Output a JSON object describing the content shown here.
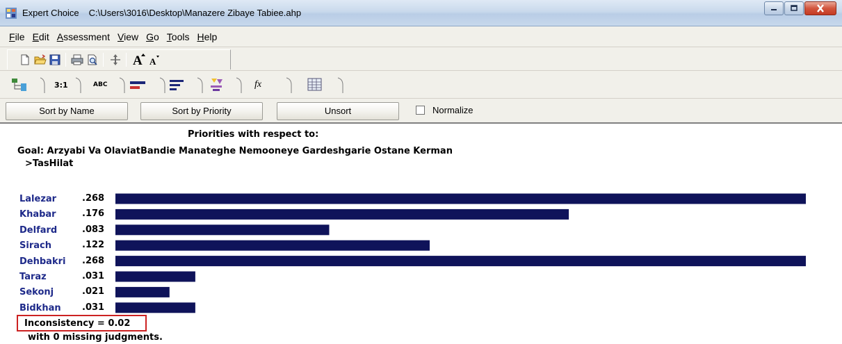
{
  "window": {
    "app_name": "Expert Choice",
    "file_path": "C:\\Users\\3016\\Desktop\\Manazere Zibaye Tabiee.ahp",
    "minimize_icon": "minimize-icon",
    "maximize_icon": "maximize-icon",
    "close_icon": "close-icon"
  },
  "menu": {
    "items": [
      {
        "label": "File",
        "key": "F",
        "rest": "ile"
      },
      {
        "label": "Edit",
        "key": "E",
        "rest": "dit"
      },
      {
        "label": "Assessment",
        "key": "A",
        "rest": "ssessment"
      },
      {
        "label": "View",
        "key": "V",
        "rest": "iew"
      },
      {
        "label": "Go",
        "key": "G",
        "rest": "o"
      },
      {
        "label": "Tools",
        "key": "T",
        "rest": "ools"
      },
      {
        "label": "Help",
        "key": "H",
        "rest": "elp"
      }
    ]
  },
  "toolbar": {
    "icons": [
      "new-file-icon",
      "open-folder-icon",
      "save-icon",
      "print-icon",
      "print-preview-icon",
      "move-icon",
      "increase-font-icon",
      "decrease-font-icon"
    ]
  },
  "tabs": {
    "items": [
      {
        "name": "tree-view-tab",
        "label": ""
      },
      {
        "name": "pairwise-numerical-tab",
        "label": "3:1"
      },
      {
        "name": "verbal-tab",
        "label": "ABC"
      },
      {
        "name": "graphical-tab",
        "label": ""
      },
      {
        "name": "priorities-tab",
        "label": ""
      },
      {
        "name": "sensitivity-tab",
        "label": ""
      },
      {
        "name": "formula-tab",
        "label": "fx"
      },
      {
        "name": "grid-tab",
        "label": ""
      }
    ]
  },
  "sortbar": {
    "sort_by_name": "Sort by Name",
    "sort_by_priority": "Sort by Priority",
    "unsort": "Unsort",
    "normalize": "Normalize",
    "normalize_checked": false
  },
  "report": {
    "heading": "Priorities with respect to:",
    "goal": "Goal: Arzyabi Va OlaviatBandie Manateghe Nemooneye Gardeshgarie Ostane Kerman",
    "node": ">TasHilat",
    "inconsistency": "Inconsistency = 0.02",
    "missing": "with 0  missing judgments."
  },
  "chart_data": {
    "type": "bar",
    "orientation": "horizontal",
    "categories": [
      "Lalezar",
      "Khabar",
      "Delfard",
      "Sirach",
      "Dehbakri",
      "Taraz",
      "Sekonj",
      "Bidkhan"
    ],
    "value_labels": [
      ".268",
      ".176",
      ".083",
      ".122",
      ".268",
      ".031",
      ".021",
      ".031"
    ],
    "values": [
      0.268,
      0.176,
      0.083,
      0.122,
      0.268,
      0.031,
      0.021,
      0.031
    ],
    "bar_color": "#0f135a",
    "label_color": "#1e2a8a"
  },
  "colors": {
    "highlight_border": "#cc2222"
  }
}
